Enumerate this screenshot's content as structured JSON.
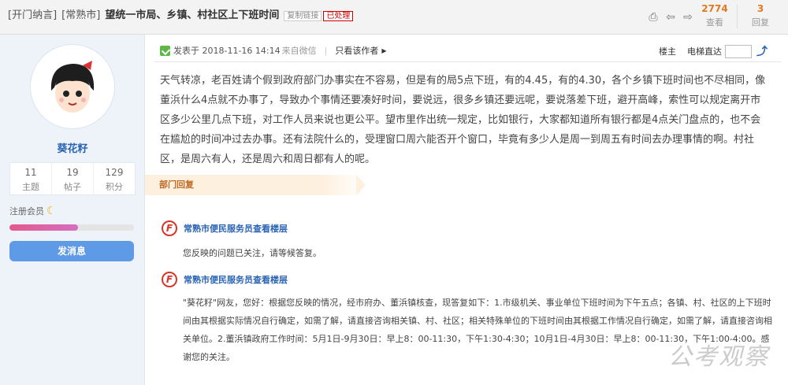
{
  "header": {
    "category1": "[开门纳言]",
    "category2": "[常熟市]",
    "title": "望统一市局、乡镇、村社区上下班时间",
    "copy_link": "复制链接",
    "status": "已处理",
    "icons": [
      "print-icon",
      "prev-icon",
      "next-icon"
    ],
    "views_count": "2774",
    "views_label": "查看",
    "replies_count": "3",
    "replies_label": "回复"
  },
  "sidebar": {
    "username": "葵花籽",
    "stats": [
      {
        "value": "11",
        "label": "主题"
      },
      {
        "value": "19",
        "label": "帖子"
      },
      {
        "value": "129",
        "label": "积分"
      }
    ],
    "member_level": "注册会员",
    "level_progress": 0.55,
    "message_button": "发消息"
  },
  "post": {
    "posted_at": "发表于 2018-11-16 14:14",
    "from": "来自微信",
    "author_only": "只看该作者",
    "floor_label": "楼主",
    "elevator_label": "电梯直达",
    "content": "天气转凉，老百姓请个假到政府部门办事实在不容易，但是有的局5点下班，有的4.45，有的4.30，各个乡镇下班时间也不尽相同，像董浜什么4点就不办事了，导致办个事情还要凑好时间，要说远，很多乡镇还要远呢，要说落差下班，避开高峰，索性可以规定离开市区多少公里几点下班，对工作人员来说也更公平。望市里作出统一规定，比如银行，大家都知道所有银行都是4点关门盘点的，也不会在尴尬的时间冲过去办事。还有法院什么的，受理窗口周六能否开个窗口，毕竟有多少人是周一到周五有时间去办理事情的啊。村社区，是周六有人，还是周六和周日都有人的呢。"
  },
  "dept": {
    "label": "部门回复",
    "replies": [
      {
        "logo": "F",
        "name": "常熟市便民服务员查看楼层",
        "text": "您反映的问题已关注，请等候答复。"
      },
      {
        "logo": "F",
        "name": "常熟市便民服务员查看楼层",
        "text": "\"葵花籽\"网友，您好：根据您反映的情况，经市府办、董浜镇核查，现答复如下：1.市级机关、事业单位下班时间为下午五点；各镇、村、社区的上下班时间由其根据实际情况自行确定，如需了解，请直接咨询相关镇、村、社区；相关特殊单位的下班时间由其根据工作情况自行确定，如需了解，请直接咨询相关单位。2.董浜镇政府工作时间：5月1日-9月30日：早上8：00-11:30，下午1:30-4:30；10月1日-4月30日：早上8：00-11:30，下午1:00-4:00。感谢您的关注。"
      }
    ]
  },
  "watermark": "公考观察"
}
